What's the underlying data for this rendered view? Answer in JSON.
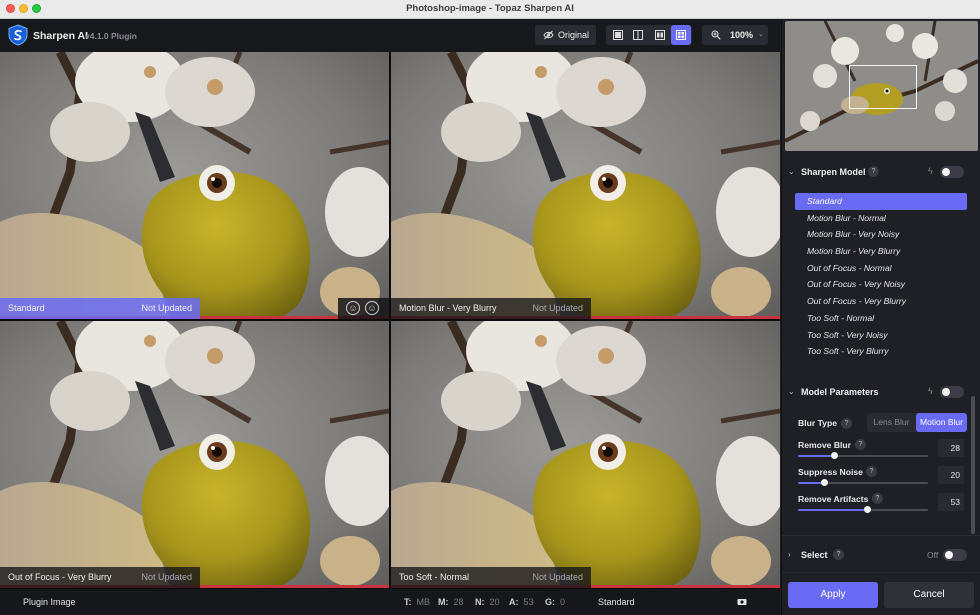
{
  "window": {
    "title": "Photoshop-image - Topaz Sharpen AI"
  },
  "app": {
    "name": "Sharpen AI",
    "version": "v4.1.0 Plugin"
  },
  "toolbar": {
    "original_label": "Original",
    "zoom_value": "100%",
    "active_view": "quad-view"
  },
  "previews": [
    {
      "name": "Standard",
      "status": "Not Updated",
      "selected": true
    },
    {
      "name": "Motion Blur - Very Blurry",
      "status": "Not Updated",
      "selected": false
    },
    {
      "name": "Out of Focus - Very Blurry",
      "status": "Not Updated",
      "selected": false
    },
    {
      "name": "Too Soft - Normal",
      "status": "Not Updated",
      "selected": false
    }
  ],
  "status_bar": {
    "source": "Plugin Image",
    "stats": [
      {
        "key": "T:",
        "value": "MB"
      },
      {
        "key": "M:",
        "value": "28"
      },
      {
        "key": "N:",
        "value": "20"
      },
      {
        "key": "A:",
        "value": "53"
      },
      {
        "key": "G:",
        "value": "0"
      }
    ],
    "model": "Standard"
  },
  "sharpen_model": {
    "title": "Sharpen Model",
    "help": "?",
    "items": [
      "Standard",
      "Motion Blur - Normal",
      "Motion Blur - Very Noisy",
      "Motion Blur - Very Blurry",
      "Out of Focus - Normal",
      "Out of Focus - Very Noisy",
      "Out of Focus - Very Blurry",
      "Too Soft - Normal",
      "Too Soft - Very Noisy",
      "Too Soft - Very Blurry"
    ],
    "selected": "Standard"
  },
  "model_parameters": {
    "title": "Model Parameters",
    "blur_type_label": "Blur Type",
    "blur_type_options": [
      "Lens Blur",
      "Motion Blur"
    ],
    "blur_type_selected": "Motion Blur",
    "remove_blur": {
      "label": "Remove Blur",
      "value": "28",
      "level": 0.28
    },
    "suppress_noise": {
      "label": "Suppress Noise",
      "value": "20",
      "level": 0.2
    },
    "remove_artifacts": {
      "label": "Remove Artifacts",
      "value": "53",
      "level": 0.53
    }
  },
  "select": {
    "title": "Select",
    "state": "Off"
  },
  "actions": {
    "apply": "Apply",
    "cancel": "Cancel"
  },
  "colors": {
    "accent": "#6a6bf5",
    "warning_bar": "#c8333d",
    "panel_bg": "#1f2026"
  }
}
